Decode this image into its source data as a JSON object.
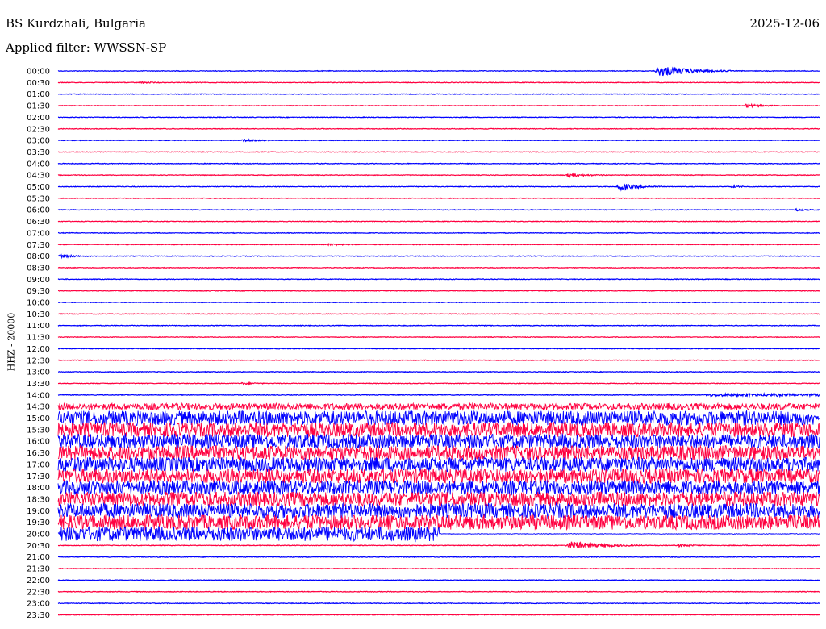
{
  "header": {
    "station": "BS Kurdzhali, Bulgaria",
    "date": "2025-12-06",
    "filter": "Applied filter: WWSSN-SP"
  },
  "chart_data": {
    "type": "line",
    "title": "BS Kurdzhali, Bulgaria",
    "ylabel": "HHZ - 20000",
    "row_labels": [
      "00:00",
      "00:30",
      "01:00",
      "01:30",
      "02:00",
      "02:30",
      "03:00",
      "03:30",
      "04:00",
      "04:30",
      "05:00",
      "05:30",
      "06:00",
      "06:30",
      "07:00",
      "07:30",
      "08:00",
      "08:30",
      "09:00",
      "09:30",
      "10:00",
      "10:30",
      "11:00",
      "11:30",
      "12:00",
      "12:30",
      "13:00",
      "13:30",
      "14:00",
      "14:30",
      "15:00",
      "15:30",
      "16:00",
      "16:30",
      "17:00",
      "17:30",
      "18:00",
      "18:30",
      "19:00",
      "19:30",
      "20:00",
      "20:30",
      "21:00",
      "21:30",
      "22:00",
      "22:30",
      "23:00",
      "23:30"
    ],
    "trace_colors": [
      "#0000ff",
      "#ff0040"
    ],
    "trace_minutes": 30,
    "events": [
      {
        "row": "00:00",
        "start_min": 23.5,
        "duration_min": 3.0,
        "amplitude": 3.4
      },
      {
        "row": "00:30",
        "start_min": 3.2,
        "duration_min": 1.0,
        "amplitude": 0.5
      },
      {
        "row": "01:30",
        "start_min": 27.0,
        "duration_min": 1.5,
        "amplitude": 1.1
      },
      {
        "row": "03:00",
        "start_min": 7.2,
        "duration_min": 1.2,
        "amplitude": 0.7
      },
      {
        "row": "04:30",
        "start_min": 20.0,
        "duration_min": 1.6,
        "amplitude": 1.0
      },
      {
        "row": "05:00",
        "start_min": 22.0,
        "duration_min": 1.8,
        "amplitude": 2.2
      },
      {
        "row": "05:00",
        "start_min": 26.5,
        "duration_min": 0.8,
        "amplitude": 0.7
      },
      {
        "row": "06:00",
        "start_min": 29.0,
        "duration_min": 1.0,
        "amplitude": 0.6
      },
      {
        "row": "07:30",
        "start_min": 10.6,
        "duration_min": 1.2,
        "amplitude": 0.6
      },
      {
        "row": "08:00",
        "start_min": 0.0,
        "duration_min": 1.6,
        "amplitude": 0.9
      },
      {
        "row": "13:30",
        "start_min": 7.2,
        "duration_min": 1.0,
        "amplitude": 0.7
      }
    ],
    "noise_segments": [
      {
        "from_row": "14:00",
        "start_min": 25.5,
        "amplitude": 1.6
      },
      {
        "from_row": "14:30",
        "start_min": 0.0,
        "amplitude": 4.0
      },
      {
        "from_row": "15:00",
        "start_min": 0.0,
        "amplitude": 9.0
      },
      {
        "to_row": "20:00",
        "end_min": 15.0,
        "amplitude": 9.0
      }
    ],
    "quiet_tail": [
      {
        "row": "20:30",
        "start_min": 20.0,
        "duration_min": 3.0,
        "amplitude": 2.4
      },
      {
        "row": "20:30",
        "start_min": 24.4,
        "duration_min": 1.0,
        "amplitude": 0.9
      }
    ]
  }
}
